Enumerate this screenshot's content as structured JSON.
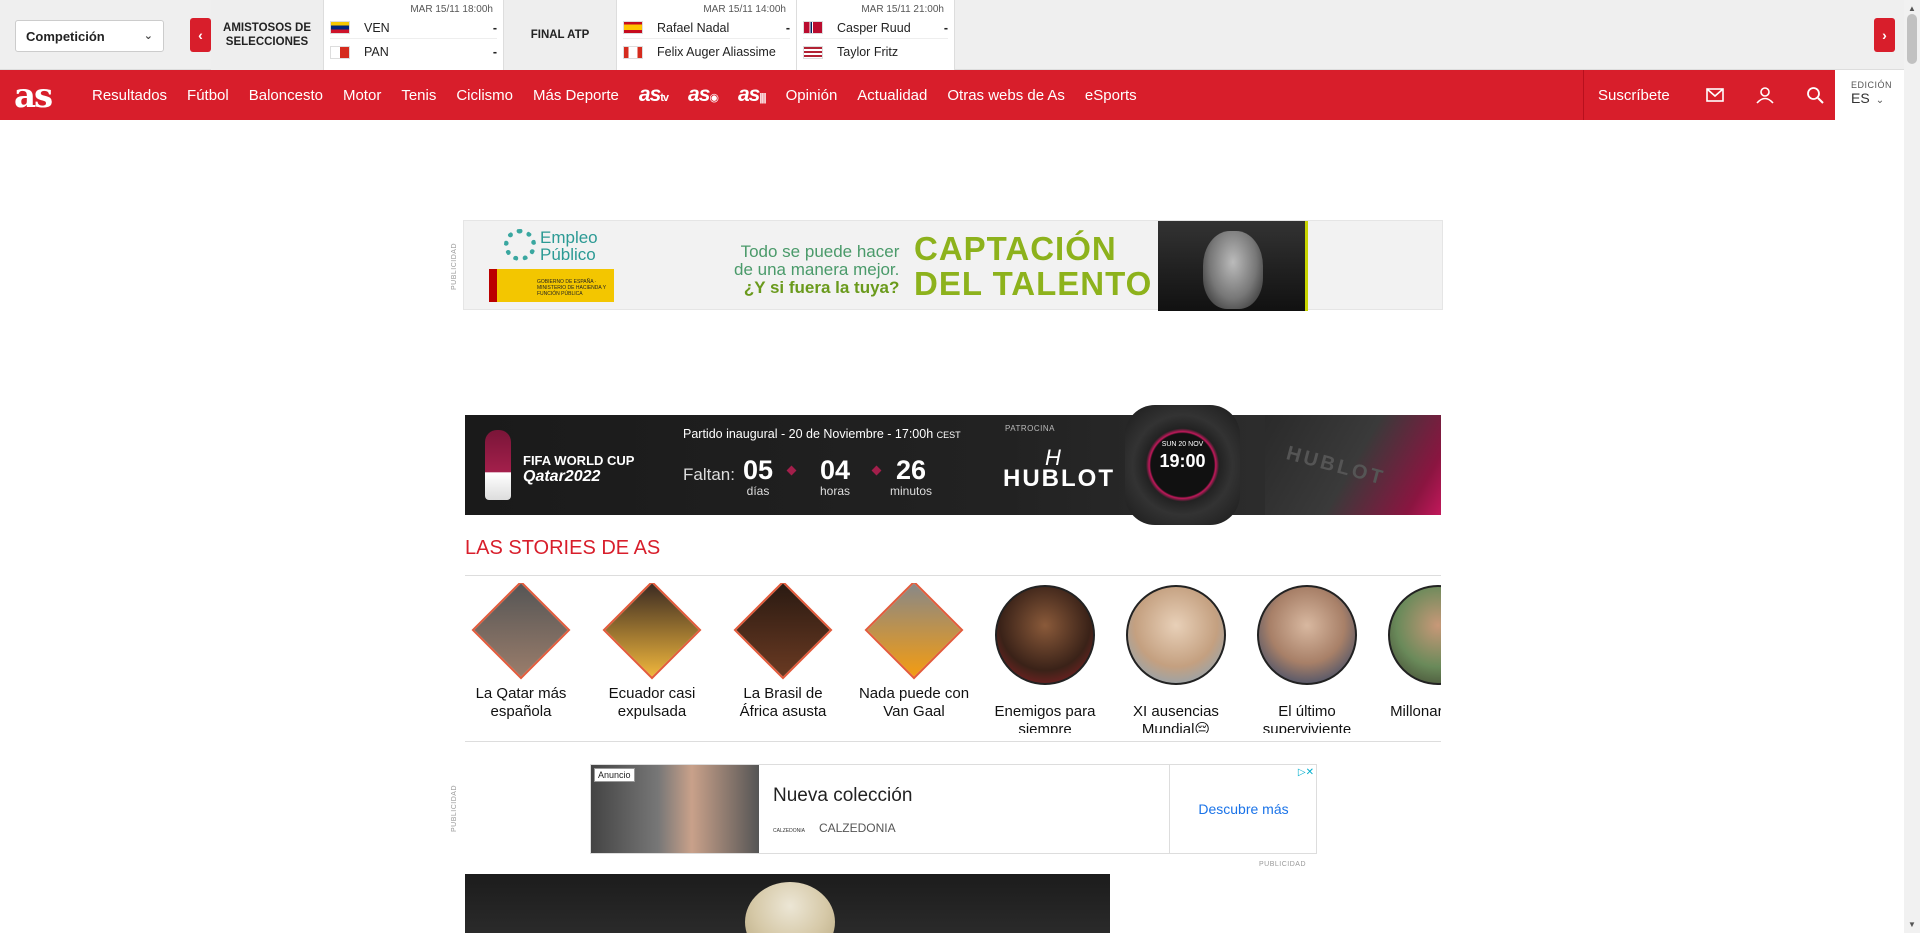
{
  "scorebar": {
    "competition_select": "Competición",
    "groups": [
      {
        "category": "AMISTOSOS DE SELECCIONES",
        "matches": [
          {
            "date": "MAR 15/11 18:00h",
            "team1": "VEN",
            "score1": "-",
            "team2": "PAN",
            "score2": "-",
            "flag1": "#f6c700",
            "flag2": "#d52b1e"
          }
        ]
      },
      {
        "category": "FINAL ATP",
        "matches": [
          {
            "date": "MAR 15/11 14:00h",
            "team1": "Rafael Nadal",
            "score1": "-",
            "team2": "Felix Auger Aliassime",
            "score2": "",
            "flag1": "#c60b1e",
            "flag2": "#d52b1e"
          },
          {
            "date": "MAR 15/11 21:00h",
            "team1": "Casper Ruud",
            "score1": "-",
            "team2": "Taylor Fritz",
            "score2": "",
            "flag1": "#ba0c2f",
            "flag2": "#3c3b6e"
          }
        ]
      }
    ]
  },
  "nav": {
    "logo": "as",
    "items": [
      "Resultados",
      "Fútbol",
      "Baloncesto",
      "Motor",
      "Tenis",
      "Ciclismo",
      "Más Deporte"
    ],
    "brands": [
      {
        "text": "as",
        "suffix": "tv"
      },
      {
        "text": "as",
        "suffix": "◉"
      },
      {
        "text": "as",
        "suffix": "|||"
      }
    ],
    "items2": [
      "Opinión",
      "Actualidad",
      "Otras webs de As",
      "eSports"
    ],
    "subscribe": "Suscríbete",
    "edition_label": "EDICIÓN",
    "edition_value": "ES",
    "brand_color": "#d81e2b"
  },
  "ad1": {
    "label": "PUBLICIDAD",
    "logo_text_1": "Empleo",
    "logo_text_2": "Público",
    "gov_text": "GOBIERNO DE ESPAÑA · MINISTERIO DE HACIENDA Y FUNCIÓN PÚBLICA",
    "tag_line_1": "Todo se puede hacer",
    "tag_line_2": "de una manera mejor.",
    "tag_line_3": "¿Y si fuera la tuya?",
    "big_1": "CAPTACIÓN",
    "big_2": "DEL TALENTO"
  },
  "worldcup": {
    "logo_1": "FIFA WORLD CUP",
    "logo_2": "Qatar2022",
    "inaugural": "Partido inaugural - 20 de Noviembre - 17:00h",
    "tz": "CEST",
    "faltan": "Faltan:",
    "days": "05",
    "days_label": "días",
    "hours": "04",
    "hours_label": "horas",
    "minutes": "26",
    "minutes_label": "minutos",
    "sponsor_label": "PATROCINA",
    "sponsor": "HUBLOT",
    "watch_date": "SUN 20 NOV",
    "watch_time": "19:00"
  },
  "stories": {
    "title": "LAS STORIES DE AS",
    "items": [
      {
        "label": "La Qatar más española",
        "shape": "diamond"
      },
      {
        "label": "Ecuador casi expulsada",
        "shape": "diamond"
      },
      {
        "label": "La Brasil de África asusta",
        "shape": "diamond"
      },
      {
        "label": "Nada puede con Van Gaal",
        "shape": "diamond"
      },
      {
        "label": "Enemigos para siempre",
        "shape": "circle"
      },
      {
        "label": "XI ausencias Mundial😔",
        "shape": "circle"
      },
      {
        "label": "El último superviviente",
        "shape": "circle"
      },
      {
        "label": "Millonar el ska",
        "shape": "circle"
      }
    ]
  },
  "ad2": {
    "label": "PUBLICIDAD",
    "anuncio": "Anuncio",
    "title": "Nueva colección",
    "brand_small": "CALZEDONIA",
    "brand": "CALZEDONIA",
    "cta": "Descubre más",
    "bottom_label": "PUBLICIDAD"
  }
}
